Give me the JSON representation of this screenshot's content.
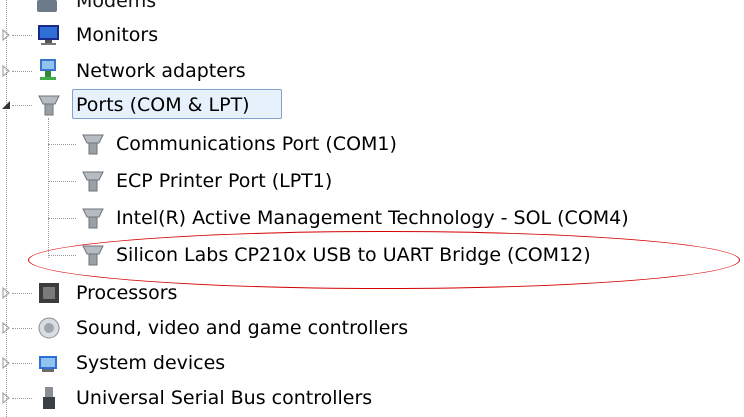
{
  "tree": {
    "partial_top_label": "Modems",
    "items": [
      {
        "label": "Monitors",
        "icon": "monitor-icon",
        "expanded": false
      },
      {
        "label": "Network adapters",
        "icon": "network-adapter-icon",
        "expanded": false
      },
      {
        "label": "Ports (COM & LPT)",
        "icon": "port-icon",
        "expanded": true,
        "selected": true,
        "children": [
          {
            "label": "Communications Port (COM1)",
            "icon": "port-icon"
          },
          {
            "label": "ECP Printer Port (LPT1)",
            "icon": "port-icon"
          },
          {
            "label": "Intel(R) Active Management Technology - SOL (COM4)",
            "icon": "port-icon"
          },
          {
            "label": "Silicon Labs CP210x USB to UART Bridge (COM12)",
            "icon": "port-icon",
            "circled": true
          }
        ]
      },
      {
        "label": "Processors",
        "icon": "processor-icon",
        "expanded": false
      },
      {
        "label": "Sound, video and game controllers",
        "icon": "speaker-icon",
        "expanded": false
      },
      {
        "label": "System devices",
        "icon": "system-devices-icon",
        "expanded": false
      },
      {
        "label": "Universal Serial Bus controllers",
        "icon": "usb-icon",
        "expanded": false
      }
    ]
  },
  "colors": {
    "highlight_ellipse": "#d40000",
    "selection_border": "#7da2ce",
    "selection_fill": "#e7f1fb"
  }
}
